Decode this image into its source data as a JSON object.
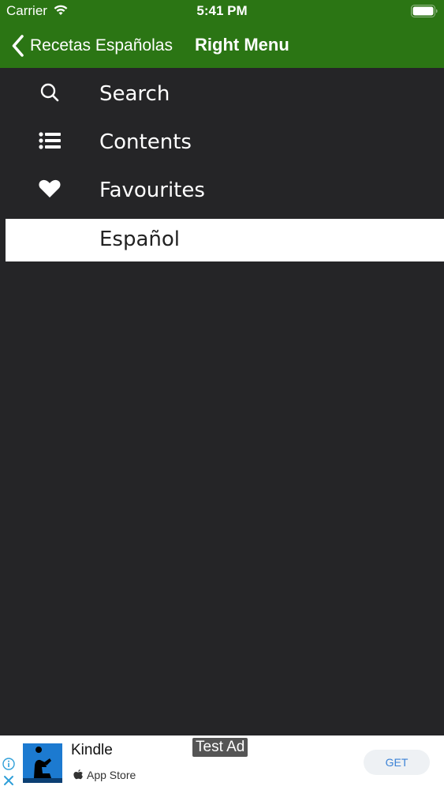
{
  "status_bar": {
    "carrier": "Carrier",
    "time": "5:41 PM"
  },
  "nav": {
    "back_label": "Recetas Españolas",
    "title": "Right Menu"
  },
  "menu": {
    "items": [
      {
        "label": "Search",
        "icon": "search-icon"
      },
      {
        "label": "Contents",
        "icon": "list-icon"
      },
      {
        "label": "Favourites",
        "icon": "heart-icon"
      },
      {
        "label": "Español",
        "selected": true
      }
    ]
  },
  "ad": {
    "app_name": "Kindle",
    "store": "App Store",
    "test_label": "Test Ad",
    "cta": "GET"
  },
  "colors": {
    "nav_green": "#2b7514",
    "menu_background": "#252527",
    "selected_background": "#ffffff",
    "cta_text": "#3b82d6"
  }
}
